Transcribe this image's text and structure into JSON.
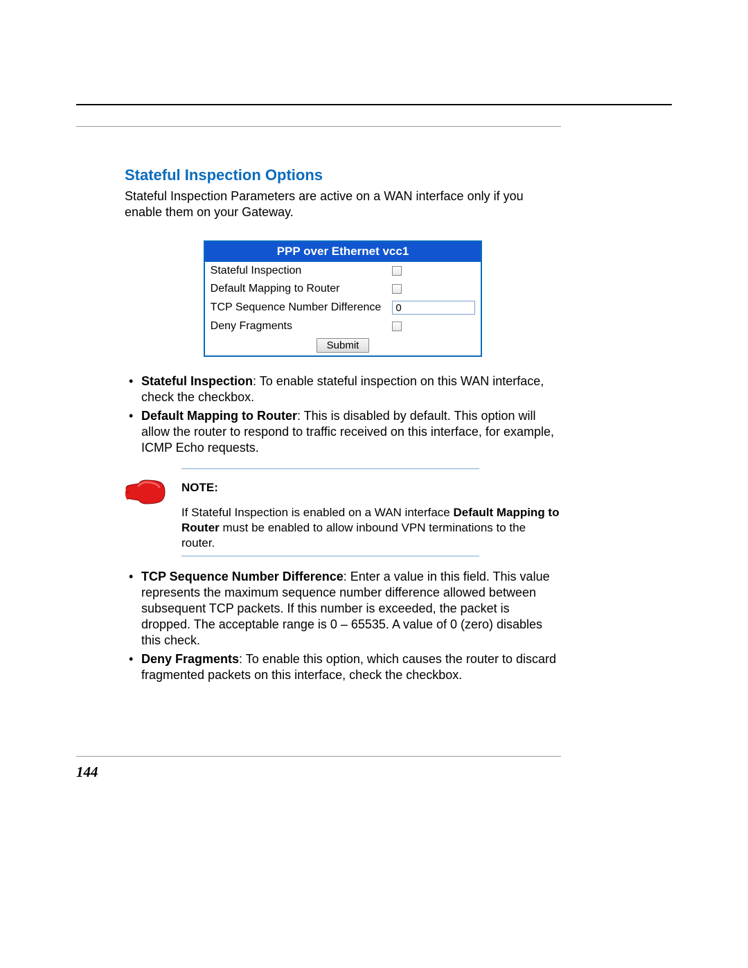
{
  "section_title": "Stateful Inspection Options",
  "intro": "Stateful Inspection Parameters are active on a WAN interface only if you enable them on your Gateway.",
  "panel": {
    "header": "PPP over Ethernet vcc1",
    "rows": {
      "stateful_inspection": "Stateful Inspection",
      "default_mapping": "Default Mapping to Router",
      "tcp_seq_diff": "TCP Sequence Number Difference",
      "tcp_seq_diff_value": "0",
      "deny_fragments": "Deny Fragments"
    },
    "submit_label": "Submit"
  },
  "bullets_top": [
    {
      "term": "Stateful Inspection",
      "text": ": To enable stateful inspection on this WAN interface, check the checkbox."
    },
    {
      "term": "Default Mapping to Router",
      "text": ": This is disabled by default. This option will allow the router to respond to traffic received on this interface, for example, ICMP Echo requests."
    }
  ],
  "note": {
    "label": "NOTE:",
    "text_pre": "If Stateful Inspection is enabled on a WAN interface ",
    "text_bold": "Default Mapping to Router",
    "text_post": " must be enabled to allow inbound VPN terminations to the router."
  },
  "bullets_bottom": [
    {
      "term": "TCP Sequence Number Difference",
      "text": ": Enter a value in this field. This value represents the maximum sequence number difference allowed between subsequent TCP packets. If this number is exceeded, the packet is dropped. The acceptable range is 0 – 65535. A value of 0 (zero) disables this check."
    },
    {
      "term": "Deny Fragments",
      "text": ": To enable this option, which causes the router to discard fragmented packets on this interface, check the checkbox."
    }
  ],
  "page_number": "144"
}
